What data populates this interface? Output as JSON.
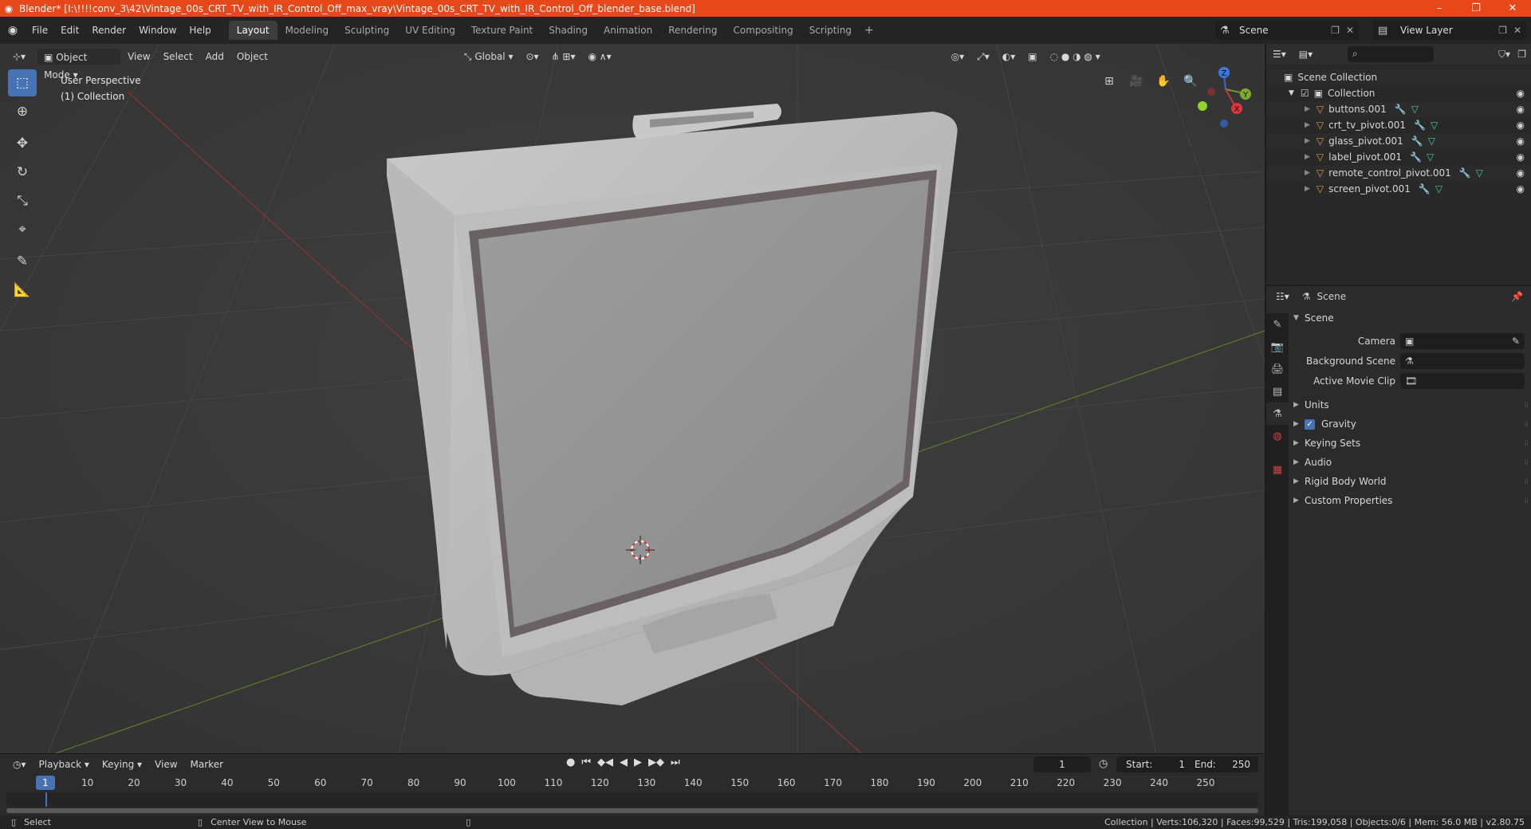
{
  "window": {
    "title": "Blender* [I:\\!!!!conv_3\\42\\Vintage_00s_CRT_TV_with_IR_Control_Off_max_vray\\Vintage_00s_CRT_TV_with_IR_Control_Off_blender_base.blend]",
    "controls": [
      "–",
      "❐",
      "✕"
    ]
  },
  "menu": [
    "File",
    "Edit",
    "Render",
    "Window",
    "Help"
  ],
  "workspaces": [
    "Layout",
    "Modeling",
    "Sculpting",
    "UV Editing",
    "Texture Paint",
    "Shading",
    "Animation",
    "Rendering",
    "Compositing",
    "Scripting"
  ],
  "active_workspace": "Layout",
  "scene_name": "Scene",
  "view_layer": "View Layer",
  "viewport": {
    "mode": "Object Mode",
    "menus": [
      "View",
      "Select",
      "Add",
      "Object"
    ],
    "transform_orientation": "Global",
    "overlay_line1": "User Perspective",
    "overlay_line2": "(1) Collection",
    "gizmo_axes": [
      "X",
      "Y",
      "Z"
    ]
  },
  "outliner": {
    "root": "Scene Collection",
    "collection": "Collection",
    "objects": [
      "buttons.001",
      "crt_tv_pivot.001",
      "glass_pivot.001",
      "label_pivot.001",
      "remote_control_pivot.001",
      "screen_pivot.001"
    ]
  },
  "properties": {
    "context": "Scene",
    "section": "Scene",
    "fields": [
      {
        "label": "Camera",
        "value": ""
      },
      {
        "label": "Background Scene",
        "value": ""
      },
      {
        "label": "Active Movie Clip",
        "value": ""
      }
    ],
    "subpanels": [
      "Units",
      "Gravity",
      "Keying Sets",
      "Audio",
      "Rigid Body World",
      "Custom Properties"
    ],
    "gravity_enabled": true
  },
  "timeline": {
    "menus": [
      "Playback",
      "Keying",
      "View",
      "Marker"
    ],
    "current_frame": "1",
    "start_label": "Start:",
    "start": "1",
    "end_label": "End:",
    "end": "250",
    "ruler": [
      "1",
      "10",
      "20",
      "30",
      "40",
      "50",
      "60",
      "70",
      "80",
      "90",
      "100",
      "110",
      "120",
      "130",
      "140",
      "150",
      "160",
      "170",
      "180",
      "190",
      "200",
      "210",
      "220",
      "230",
      "240",
      "250"
    ]
  },
  "statusbar": {
    "left_action": "Select",
    "middle_action": "Center View to Mouse",
    "stats": "Collection | Verts:106,320 | Faces:99,529 | Tris:199,058 | Objects:0/6 | Mem: 56.0 MB | v2.80.75"
  }
}
